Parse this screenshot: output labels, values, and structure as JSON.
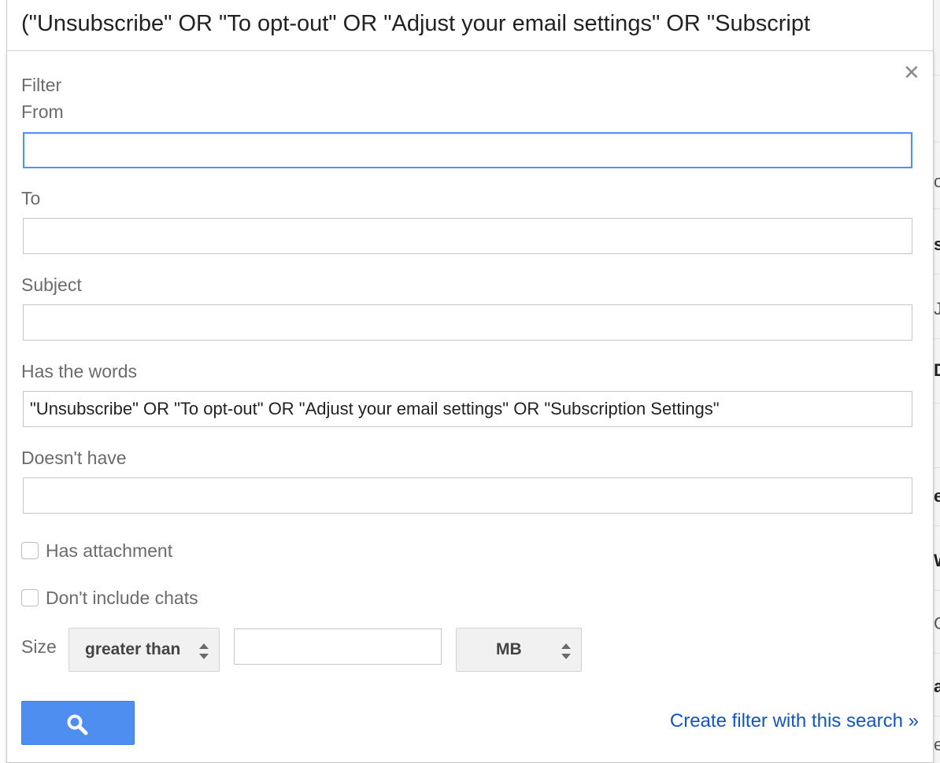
{
  "search": {
    "query": "(\"Unsubscribe\" OR \"To opt-out\" OR \"Adjust your email settings\" OR \"Subscript"
  },
  "filter_panel": {
    "title": "Filter",
    "from_label": "From",
    "from_value": "",
    "to_label": "To",
    "to_value": "",
    "subject_label": "Subject",
    "subject_value": "",
    "has_words_label": "Has the words",
    "has_words_value": "\"Unsubscribe\" OR \"To opt-out\" OR \"Adjust your email settings\" OR \"Subscription Settings\"",
    "doesnt_have_label": "Doesn't have",
    "doesnt_have_value": "",
    "has_attachment_label": "Has attachment",
    "has_attachment_checked": false,
    "dont_include_chats_label": "Don't include chats",
    "dont_include_chats_checked": false,
    "size_label": "Size",
    "size_comparator": "greater than",
    "size_value": "",
    "size_unit": "MB",
    "create_filter_link": "Create filter with this search »",
    "close_icon": "close-icon",
    "search_icon": "search-icon",
    "accent_color": "#4d90fe",
    "button_color": "#4d8ef0",
    "link_color": "#1155cc"
  },
  "background": {
    "row_fragments": [
      "o",
      "s",
      "J",
      "D",
      "e",
      "W",
      "C",
      "a",
      "e"
    ]
  }
}
